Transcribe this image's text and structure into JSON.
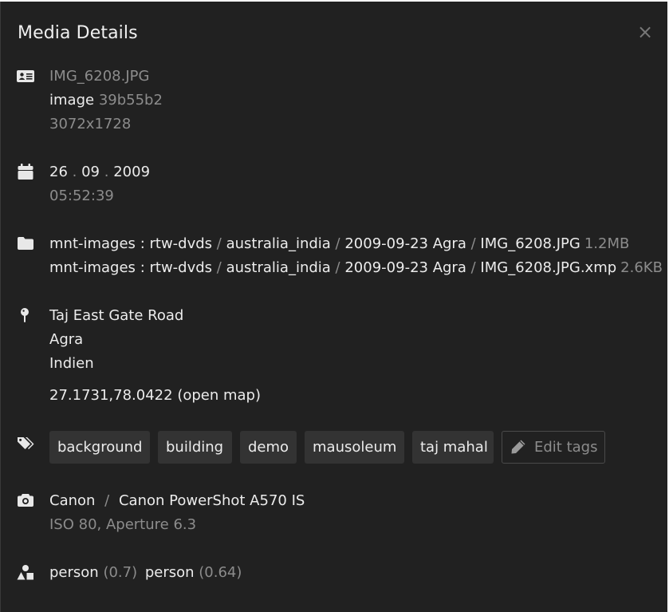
{
  "dialog": {
    "title": "Media Details",
    "close_icon": "×"
  },
  "file_info": {
    "filename": "IMG_6208.JPG",
    "type": "image",
    "hash": "39b55b2",
    "dimensions": "3072x1728"
  },
  "date": {
    "day": "26",
    "month": "09",
    "year": "2009",
    "dot": ".",
    "time": "05:52:39"
  },
  "paths": [
    {
      "root": "mnt-images",
      "colon": ":",
      "parts": [
        "rtw-dvds",
        "australia_india",
        "2009-09-23 Agra",
        "IMG_6208.JPG"
      ],
      "slash": "/",
      "size": "1.2MB"
    },
    {
      "root": "mnt-images",
      "colon": ":",
      "parts": [
        "rtw-dvds",
        "australia_india",
        "2009-09-23 Agra",
        "IMG_6208.JPG.xmp"
      ],
      "slash": "/",
      "size": "2.6KB"
    }
  ],
  "location": {
    "street": "Taj East Gate Road",
    "city": "Agra",
    "country": "Indien",
    "coordinates": "27.1731,78.0422",
    "open_map": "(open map)"
  },
  "tags": [
    "background",
    "building",
    "demo",
    "mausoleum",
    "taj mahal"
  ],
  "edit_tags_label": "Edit tags",
  "camera": {
    "make": "Canon",
    "slash": "/",
    "model": "Canon PowerShot A570 IS",
    "settings": "ISO 80, Aperture 6.3"
  },
  "objects": [
    {
      "label": "person",
      "score": "(0.7)"
    },
    {
      "label": "person",
      "score": "(0.64)"
    }
  ],
  "colors": {
    "background": "#212121",
    "tag_bg": "#333333",
    "muted": "#8c8c8c",
    "text": "#e8e8e8"
  }
}
